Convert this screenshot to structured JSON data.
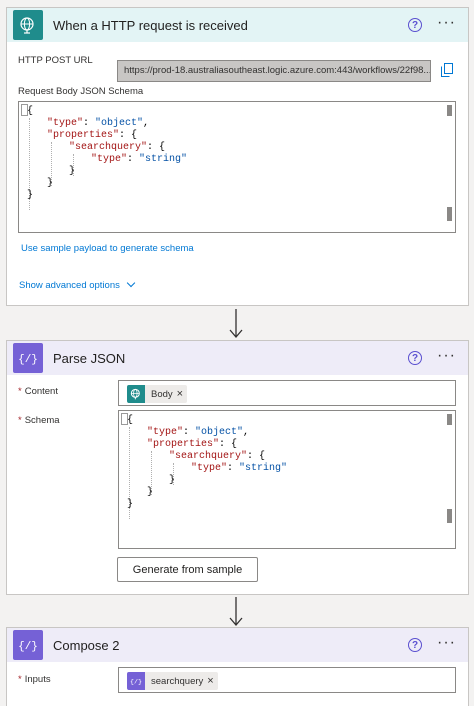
{
  "trigger": {
    "title": "When a HTTP request is received",
    "url_label": "HTTP POST URL",
    "url_value": "https://prod-18.australiasoutheast.logic.azure.com:443/workflows/22f98...",
    "schema_label": "Request Body JSON Schema",
    "code": [
      "{",
      "\"type\": \"object\",",
      "\"properties\": {",
      "\"searchquery\": {",
      "\"type\": \"string\"",
      "}",
      "}",
      "}"
    ],
    "sample_link": "Use sample payload to generate schema",
    "advanced_link": "Show advanced options"
  },
  "parse": {
    "title": "Parse JSON",
    "content_label": "Content",
    "content_token": "Body",
    "schema_label": "Schema",
    "generate_button": "Generate from sample"
  },
  "compose": {
    "title": "Compose 2",
    "inputs_label": "Inputs",
    "inputs_token": "searchquery"
  },
  "code_tokens": {
    "type_key": "\"type\"",
    "object_val": "\"object\"",
    "properties_key": "\"properties\"",
    "searchquery_key": "\"searchquery\"",
    "string_val": "\"string\""
  },
  "colors": {
    "trigger_header": "#e3f4f5",
    "trigger_icon": "#1f8c8c",
    "action_header": "#eeecf8",
    "action_icon": "#7561d6",
    "link": "#0078d4",
    "required": "#a4262c"
  },
  "icons": {
    "trigger": "globe-request-icon",
    "action": "braces-icon",
    "help": "help-circle-icon",
    "more": "more-ellipsis-icon",
    "copy": "copy-icon"
  }
}
